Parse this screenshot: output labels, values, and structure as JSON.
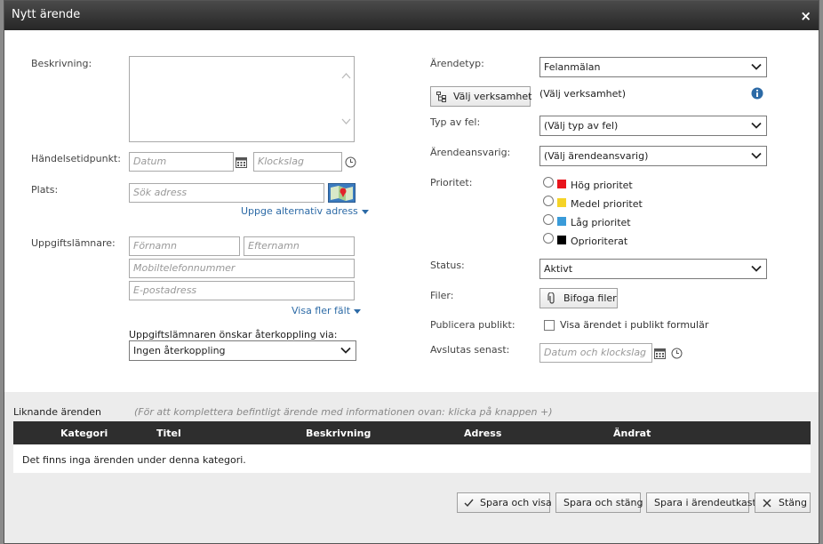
{
  "dialog": {
    "title": "Nytt ärende",
    "close_symbol": "×"
  },
  "left": {
    "beskrivning_label": "Beskrivning:",
    "handelsetidpunkt_label": "Händelsetidpunkt:",
    "datum_placeholder": "Datum",
    "klockslag_placeholder": "Klockslag",
    "plats_label": "Plats:",
    "sok_adress_placeholder": "Sök adress",
    "alt_adress_link": "Uppge alternativ adress",
    "uppgiftslamnare_label": "Uppgiftslämnare:",
    "fornamn_placeholder": "Förnamn",
    "efternamn_placeholder": "Efternamn",
    "mobil_placeholder": "Mobiltelefonnummer",
    "epost_placeholder": "E-postadress",
    "visa_fler_link": "Visa fler fält",
    "aterkoppling_label": "Uppgiftslämnaren önskar återkoppling via:",
    "aterkoppling_value": "Ingen återkoppling"
  },
  "right": {
    "arendetyp_label": "Ärendetyp:",
    "arendetyp_value": "Felanmälan",
    "valj_verksamhet_button": "Välj verksamhet",
    "valj_verksamhet_text": "(Välj verksamhet)",
    "typ_av_fel_label": "Typ av fel:",
    "typ_av_fel_value": "(Välj typ av fel)",
    "arendeansvarig_label": "Ärendeansvarig:",
    "arendeansvarig_value": "(Välj ärendeansvarig)",
    "prioritet_label": "Prioritet:",
    "priorities": [
      {
        "label": "Hög prioritet",
        "color": "#e8141c"
      },
      {
        "label": "Medel prioritet",
        "color": "#f5d327"
      },
      {
        "label": "Låg prioritet",
        "color": "#3a9bd9"
      },
      {
        "label": "Oprioriterat",
        "color": "#000000"
      }
    ],
    "status_label": "Status:",
    "status_value": "Aktivt",
    "filer_label": "Filer:",
    "bifoga_button": "Bifoga filer",
    "publicera_label": "Publicera publikt:",
    "publicera_checkbox_label": "Visa ärendet i publikt formulär",
    "avslutas_label": "Avslutas senast:",
    "avslutas_placeholder": "Datum och klockslag"
  },
  "similar": {
    "title": "Liknande ärenden",
    "hint": "(För att komplettera befintligt ärende med informationen ovan: klicka på knappen +)",
    "columns": [
      "Kategori",
      "Titel",
      "Beskrivning",
      "Adress",
      "Ändrat"
    ],
    "empty_text": "Det finns inga ärenden under denna kategori."
  },
  "footer": {
    "spara_visa": "Spara och visa",
    "spara_stang": "Spara och stäng",
    "spara_utkast": "Spara i ärendeutkast",
    "stang": "Stäng"
  },
  "colors": {
    "titlebar": "#2b2b2b",
    "link": "#2c6aa6",
    "grid_header": "#2e2e2e"
  }
}
